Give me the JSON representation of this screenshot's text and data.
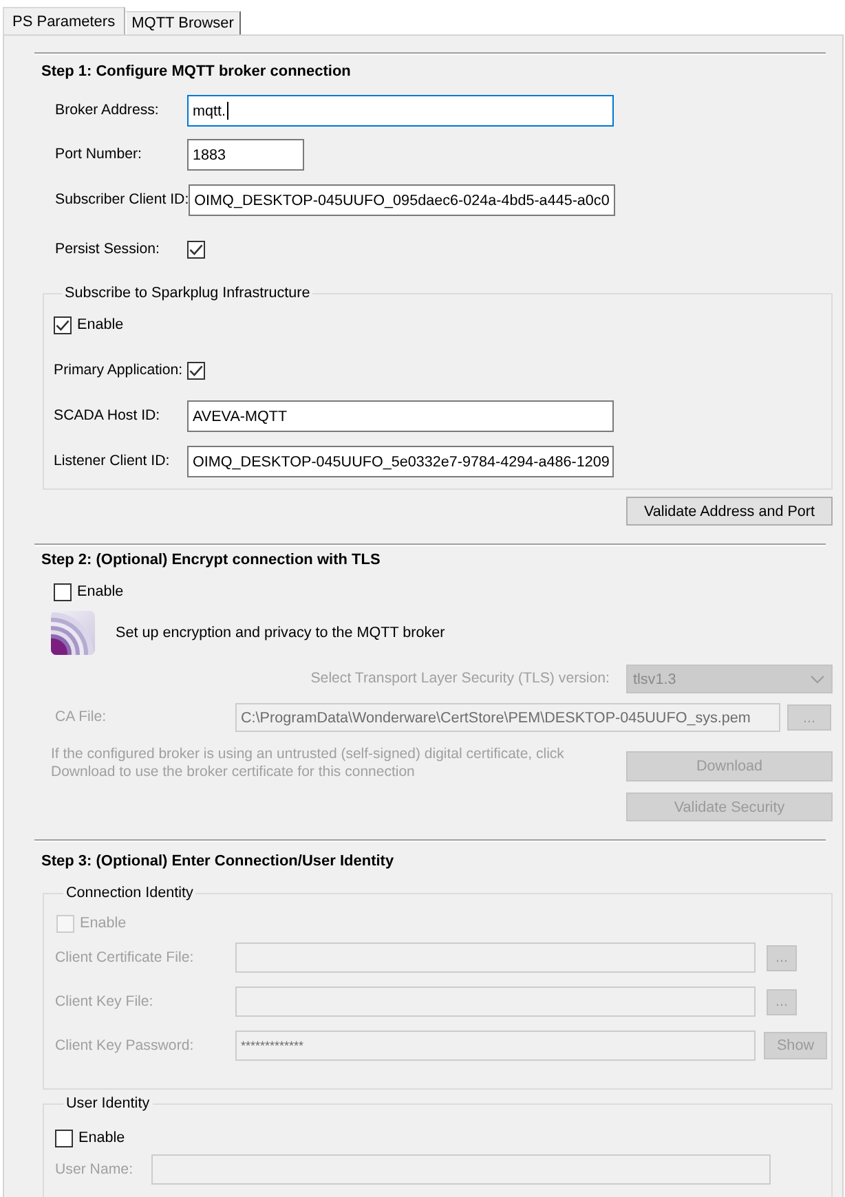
{
  "tabs": [
    {
      "label": "PS Parameters",
      "selected": true
    },
    {
      "label": "MQTT Browser",
      "selected": false
    }
  ],
  "step1": {
    "title": "Step 1: Configure MQTT broker connection",
    "rows": [
      {
        "kind": "text",
        "label": "Broker Address:",
        "value": "mqtt.",
        "focused": true
      },
      {
        "kind": "number",
        "label": "Port Number:",
        "value": "1883",
        "focused": false
      },
      {
        "kind": "text",
        "label": "Subscriber Client ID:",
        "value": "OIMQ_DESKTOP-045UUFO_095daec6-024a-4bd5-a445-a0c0",
        "focused": false
      },
      {
        "kind": "checkbox",
        "label": "Persist Session:",
        "checked": true
      }
    ],
    "sparkplug": {
      "title": "Subscribe to Sparkplug Infrastructure",
      "enable": {
        "label": "Enable",
        "checked": true,
        "disabled": false
      },
      "rows": [
        {
          "kind": "checkbox",
          "label": "Primary Application:",
          "checked": true
        },
        {
          "kind": "text",
          "label": "SCADA Host ID:",
          "value": "AVEVA-MQTT",
          "focused": false
        },
        {
          "kind": "text",
          "label": "Listener Client ID:",
          "value": "OIMQ_DESKTOP-045UUFO_5e0332e7-9784-4294-a486-1209",
          "focused": false
        }
      ]
    },
    "validate_button": {
      "label": "Validate Address and Port",
      "disabled": false
    }
  },
  "step2": {
    "title": "Step 2: (Optional) Encrypt connection with TLS",
    "enable": {
      "label": "Enable",
      "checked": false,
      "disabled": false
    },
    "description": "Set up encryption and privacy to the MQTT broker",
    "tls_version": {
      "label": "Select Transport Layer Security (TLS) version:",
      "value": "tlsv1.3",
      "disabled": true
    },
    "ca_file": {
      "label": "CA File:",
      "value": "C:\\ProgramData\\Wonderware\\CertStore\\PEM\\DESKTOP-045UUFO_sys.pem",
      "button": "...",
      "disabled": true
    },
    "note": {
      "text": "If the configured broker is using an untrusted (self-signed) digital certificate, click Download to use the broker certificate for this connection",
      "disabled": true
    },
    "buttons": [
      {
        "label": "Download",
        "disabled": true
      },
      {
        "label": "Validate Security",
        "disabled": true
      }
    ]
  },
  "step3": {
    "title": "Step 3: (Optional) Enter Connection/User Identity",
    "connection_identity": {
      "title": "Connection Identity",
      "enable": {
        "label": "Enable",
        "checked": false,
        "disabled": true
      },
      "rows": [
        {
          "kind": "file",
          "label": "Client Certificate File:",
          "button": "...",
          "disabled": true
        },
        {
          "kind": "file",
          "label": "Client Key File:",
          "button": "...",
          "disabled": true
        },
        {
          "kind": "password",
          "label": "Client Key Password:",
          "value": "*************",
          "button": "Show",
          "disabled": true
        }
      ]
    },
    "user_identity": {
      "title": "User Identity",
      "enable": {
        "label": "Enable",
        "checked": false,
        "disabled": false
      },
      "rows": [
        {
          "kind": "text",
          "label": "User Name:",
          "disabled": true
        }
      ]
    }
  }
}
